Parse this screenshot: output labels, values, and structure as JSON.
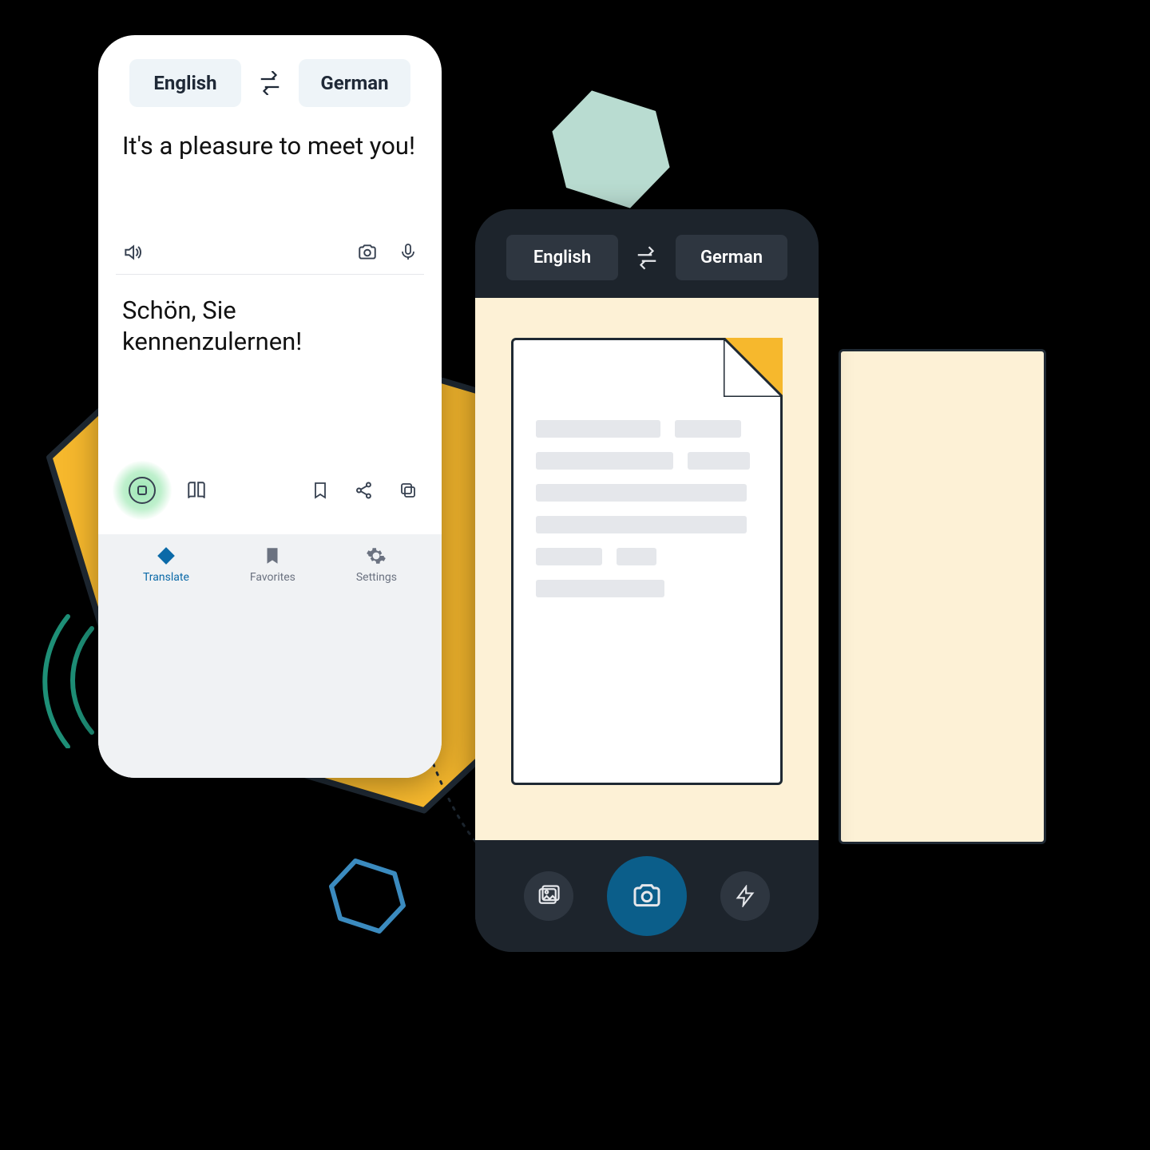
{
  "colors": {
    "accent_blue": "#0b6aa8",
    "teal": "#b9dcd1",
    "yellow": "#f6b82d",
    "dark": "#1d242c"
  },
  "phone_a": {
    "source_language": "English",
    "target_language": "German",
    "source_text": "It's a pleasure to meet you!",
    "target_text": "Schön, Sie kennenzulernen!",
    "tabs": {
      "translate": "Translate",
      "favorites": "Favorites",
      "settings": "Settings"
    }
  },
  "phone_b": {
    "source_language": "English",
    "target_language": "German"
  }
}
